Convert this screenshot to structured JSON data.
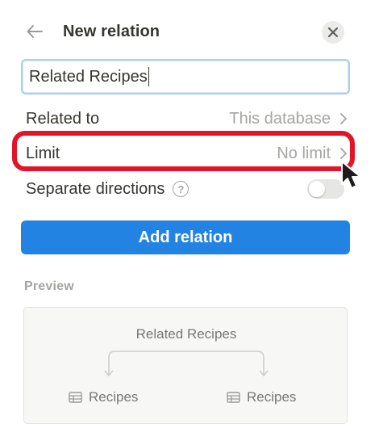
{
  "header": {
    "title": "New relation",
    "back_icon": "arrow-left-icon",
    "close_icon": "close-icon"
  },
  "name_input": {
    "value": "Related Recipes"
  },
  "options": {
    "related_to": {
      "label": "Related to",
      "value": "This database"
    },
    "limit": {
      "label": "Limit",
      "value": "No limit"
    },
    "separate_directions": {
      "label": "Separate directions",
      "help": "?",
      "enabled": false
    }
  },
  "actions": {
    "add_label": "Add relation"
  },
  "preview": {
    "label": "Preview",
    "title": "Related Recipes",
    "left_db": "Recipes",
    "right_db": "Recipes"
  },
  "colors": {
    "accent": "#2383e2",
    "highlight": "#e3142a",
    "muted_text": "#a6a5a2",
    "text": "#37352f"
  }
}
